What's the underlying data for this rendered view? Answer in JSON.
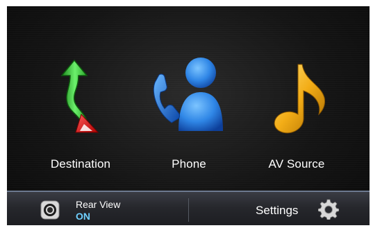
{
  "menu": {
    "destination_label": "Destination",
    "phone_label": "Phone",
    "av_source_label": "AV Source"
  },
  "bottom_bar": {
    "rear_view_label": "Rear View",
    "rear_view_status": "ON",
    "settings_label": "Settings"
  },
  "icons": {
    "destination": "route-arrow-icon",
    "phone": "phone-contact-icon",
    "av_source": "music-note-icon",
    "rear_view": "camera-ring-icon",
    "settings": "gear-icon"
  },
  "colors": {
    "rear_view_status": "#6fd0ff",
    "destination_icon": "#3cc83c",
    "phone_icon": "#2a7fe0",
    "av_icon": "#f2b21a"
  }
}
